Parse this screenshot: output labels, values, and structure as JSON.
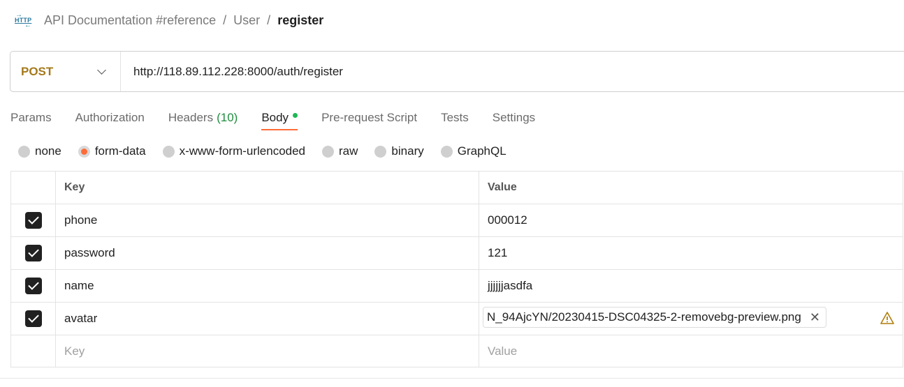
{
  "breadcrumb": {
    "icon": "http-icon",
    "items": [
      "API Documentation #reference",
      "User"
    ],
    "current": "register",
    "separator": "/"
  },
  "request": {
    "method": "POST",
    "url": "http://118.89.112.228:8000/auth/register"
  },
  "tabs": [
    {
      "label": "Params"
    },
    {
      "label": "Authorization"
    },
    {
      "label": "Headers",
      "count": "(10)"
    },
    {
      "label": "Body",
      "active": true
    },
    {
      "label": "Pre-request Script"
    },
    {
      "label": "Tests"
    },
    {
      "label": "Settings"
    }
  ],
  "body_types": [
    {
      "label": "none"
    },
    {
      "label": "form-data",
      "selected": true
    },
    {
      "label": "x-www-form-urlencoded"
    },
    {
      "label": "raw"
    },
    {
      "label": "binary"
    },
    {
      "label": "GraphQL"
    }
  ],
  "table": {
    "headers": {
      "key": "Key",
      "value": "Value"
    },
    "rows": [
      {
        "checked": true,
        "key": "phone",
        "value": "000012"
      },
      {
        "checked": true,
        "key": "password",
        "value": "121"
      },
      {
        "checked": true,
        "key": "name",
        "value": "jjjjjjasdfa"
      },
      {
        "checked": true,
        "key": "avatar",
        "file": "N_94AjcYN/20230415-DSC04325-2-removebg-preview.png"
      }
    ],
    "placeholder": {
      "key": "Key",
      "value": "Value"
    }
  },
  "colors": {
    "method": "#a5791b",
    "accent": "#ff6c37",
    "count": "#1e8e3e",
    "dot": "#1eb854"
  }
}
